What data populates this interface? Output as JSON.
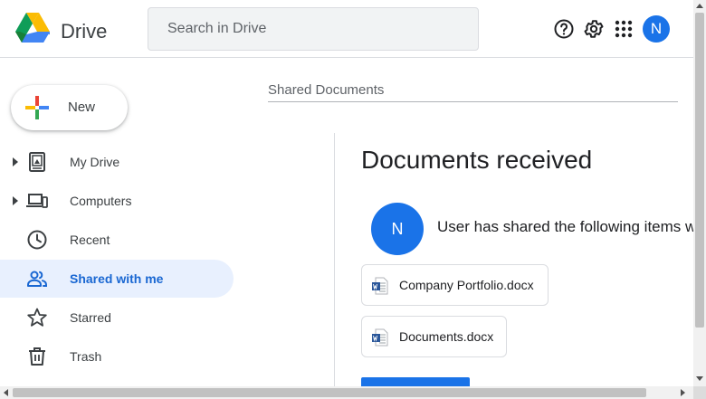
{
  "header": {
    "brand": "Drive",
    "search_placeholder": "Search in Drive",
    "avatar_initial": "N"
  },
  "sidebar": {
    "new_label": "New",
    "items": [
      {
        "label": "My Drive",
        "icon": "my-drive-icon",
        "expandable": true
      },
      {
        "label": "Computers",
        "icon": "computers-icon",
        "expandable": true
      },
      {
        "label": "Recent",
        "icon": "clock-icon",
        "expandable": false
      },
      {
        "label": "Shared with me",
        "icon": "people-icon",
        "expandable": false,
        "active": true
      },
      {
        "label": "Starred",
        "icon": "star-icon",
        "expandable": false
      },
      {
        "label": "Trash",
        "icon": "trash-icon",
        "expandable": false
      }
    ]
  },
  "main": {
    "breadcrumb": "Shared Documents",
    "panel_title": "Documents received",
    "sharer_initial": "N",
    "share_message": "User has shared the following items with you",
    "files": [
      {
        "name": "Company Portfolio.docx",
        "icon": "word-doc-icon"
      },
      {
        "name": "Documents.docx",
        "icon": "word-doc-icon"
      }
    ]
  },
  "colors": {
    "accent": "#1a73e8",
    "active_nav_bg": "#e8f0fe",
    "active_nav_text": "#1967d2",
    "google_blue": "#4285f4",
    "google_red": "#ea4335",
    "google_yellow": "#fbbc04",
    "google_green": "#34a853"
  }
}
